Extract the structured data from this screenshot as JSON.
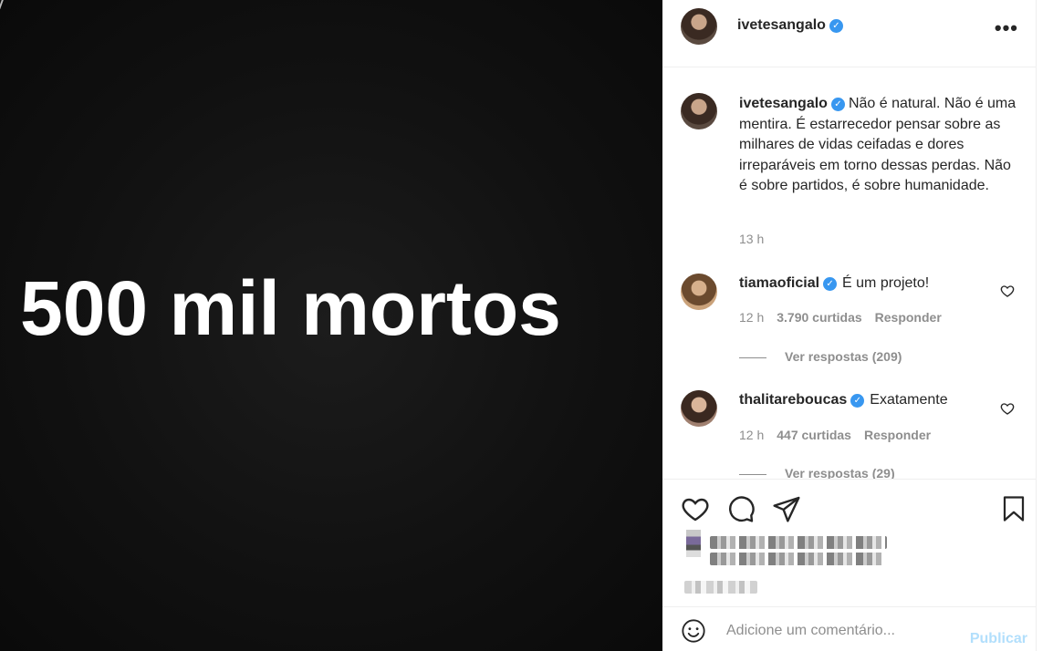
{
  "post": {
    "image_text": "500 mil mortos"
  },
  "header": {
    "username": "ivetesangalo",
    "more_icon": "more-horizontal-icon"
  },
  "caption": {
    "username": "ivetesangalo",
    "text": "Não é natural. Não é uma mentira. É estarrecedor pensar sobre as milhares de vidas ceifadas e dores irreparáveis em torno dessas perdas. Não é sobre partidos, é sobre humanidade.",
    "time": "13 h"
  },
  "comments": [
    {
      "username": "tiamaoficial",
      "text": "É um projeto!",
      "time": "12 h",
      "likes": "3.790 curtidas",
      "reply_label": "Responder",
      "view_replies": "Ver respostas (209)"
    },
    {
      "username": "thalitareboucas",
      "text": "Exatamente",
      "time": "12 h",
      "likes": "447 curtidas",
      "reply_label": "Responder",
      "view_replies": "Ver respostas (29)"
    }
  ],
  "actions": {
    "like_icon": "heart-icon",
    "comment_icon": "comment-icon",
    "share_icon": "paper-plane-icon",
    "save_icon": "bookmark-icon"
  },
  "add_comment": {
    "placeholder": "Adicione um comentário...",
    "publish_label": "Publicar",
    "emoji_icon": "emoji-icon"
  },
  "colors": {
    "verified": "#3897f0",
    "publish": "#b2dffc",
    "secondary_text": "#8e8e8e"
  }
}
